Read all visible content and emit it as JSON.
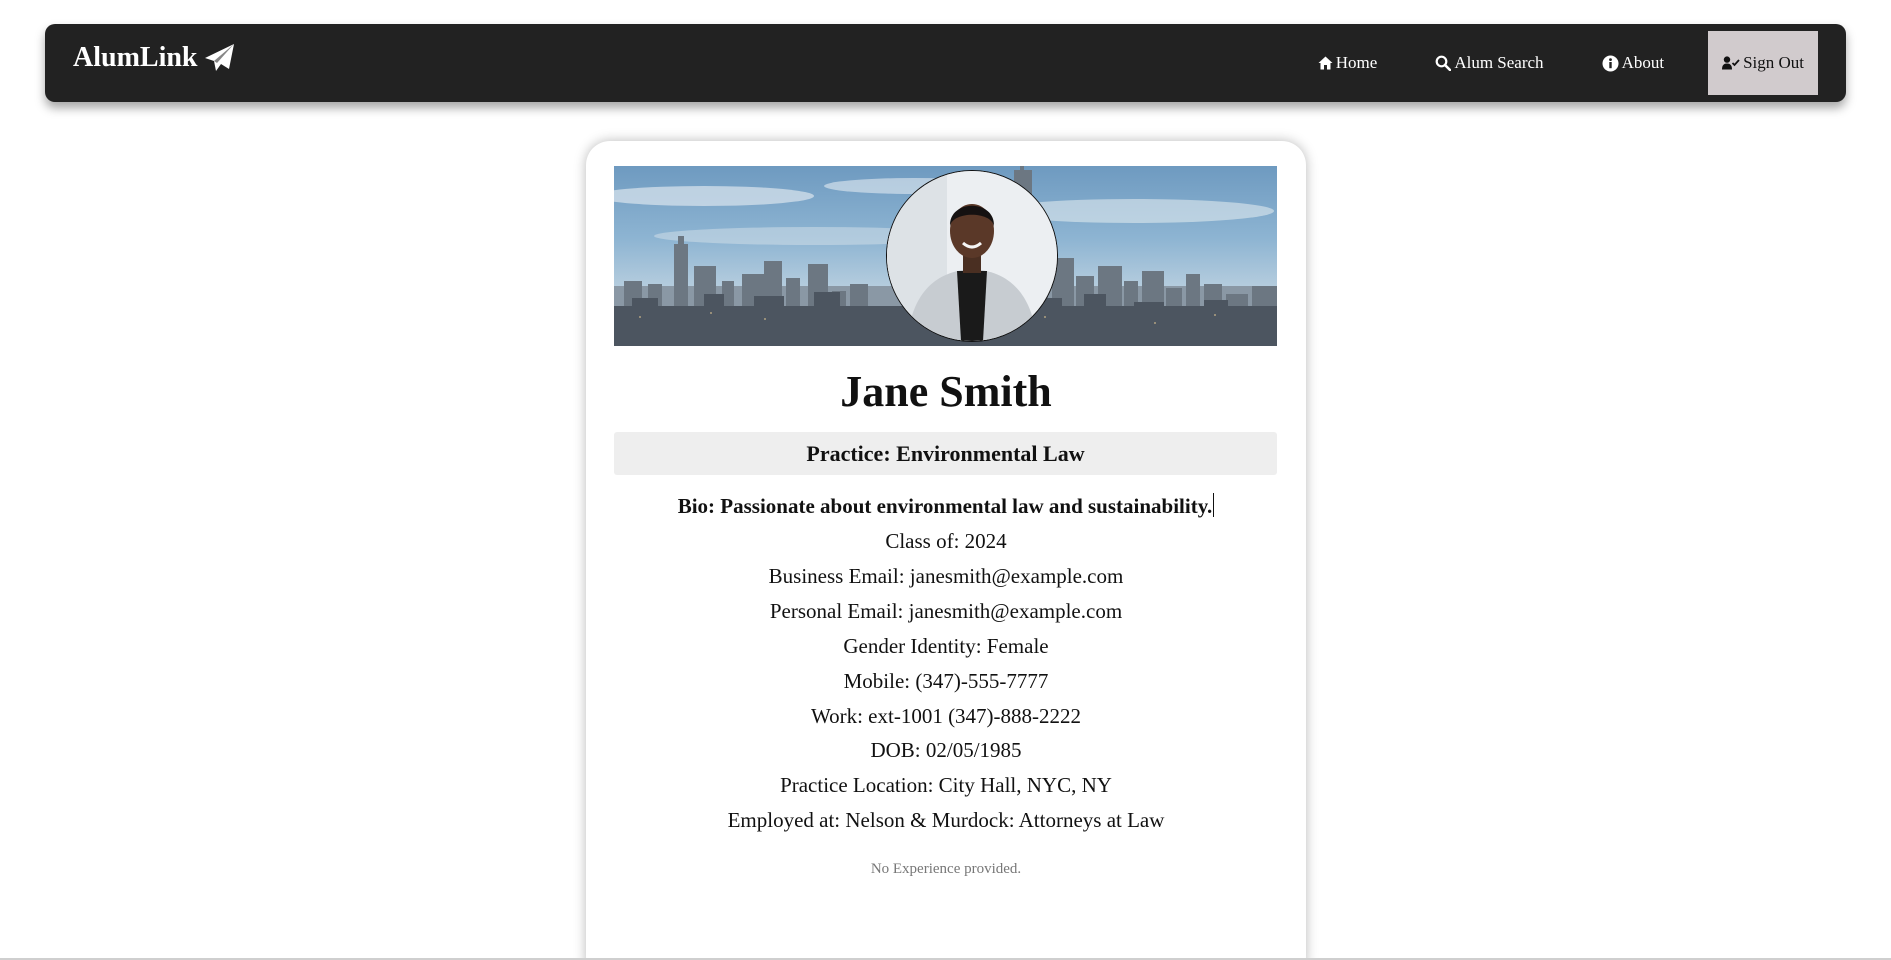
{
  "navbar": {
    "brand": "AlumLink",
    "brand_icon": "paper-plane-icon",
    "links": [
      {
        "label": "Home",
        "icon": "home-icon"
      },
      {
        "label": "Alum Search",
        "icon": "search-icon"
      },
      {
        "label": "About",
        "icon": "info-icon"
      },
      {
        "label": "Sign Out",
        "icon": "user-check-icon"
      }
    ],
    "colors": {
      "background": "#222222",
      "active_background": "#d1cbcd"
    }
  },
  "profile": {
    "name": "Jane Smith",
    "practice": "Practice: Environmental Law",
    "bio": "Bio: Passionate about environmental law and sustainability.",
    "details": [
      "Class of: 2024",
      "Business Email: janesmith@example.com",
      "Personal Email: janesmith@example.com",
      "Gender Identity: Female",
      "Mobile: (347)-555-7777",
      "Work: ext-1001 (347)-888-2222",
      "DOB: 02/05/1985",
      "Practice Location: City Hall, NYC, NY",
      "Employed at: Nelson & Murdock: Attorneys at Law"
    ],
    "experience_empty": "No Experience provided."
  }
}
